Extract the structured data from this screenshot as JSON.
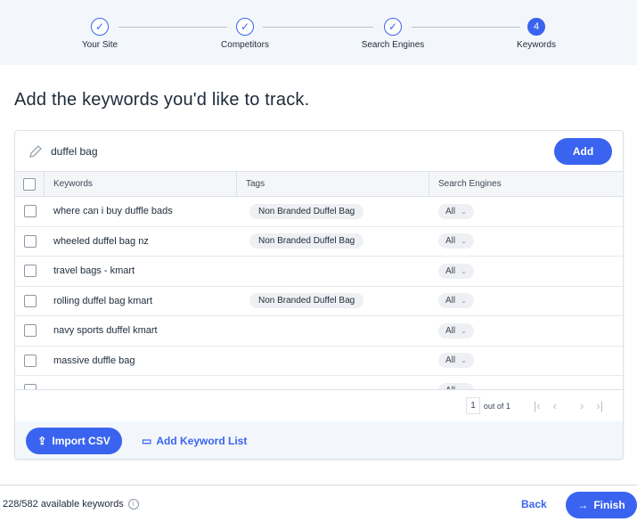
{
  "stepper": {
    "steps": [
      {
        "label": "Your Site",
        "state": "done"
      },
      {
        "label": "Competitors",
        "state": "done"
      },
      {
        "label": "Search Engines",
        "state": "done"
      },
      {
        "label": "Keywords",
        "state": "active",
        "number": "4"
      }
    ]
  },
  "title": "Add the keywords you'd like to track.",
  "input": {
    "value": "duffel bag",
    "add_label": "Add"
  },
  "table": {
    "headers": [
      "Keywords",
      "Tags",
      "Search Engines"
    ],
    "rows": [
      {
        "keyword": "where can i buy duffle bads",
        "tag": "Non Branded Duffel Bag",
        "engine": "All"
      },
      {
        "keyword": "wheeled duffel bag nz",
        "tag": "Non Branded Duffel Bag",
        "engine": "All"
      },
      {
        "keyword": "travel bags - kmart",
        "tag": "",
        "engine": "All"
      },
      {
        "keyword": "rolling duffel bag kmart",
        "tag": "Non Branded Duffel Bag",
        "engine": "All"
      },
      {
        "keyword": "navy sports duffel kmart",
        "tag": "",
        "engine": "All"
      },
      {
        "keyword": "massive duffle bag",
        "tag": "",
        "engine": "All"
      },
      {
        "keyword": "",
        "tag": "",
        "engine": "All"
      }
    ]
  },
  "pagination": {
    "page": "1",
    "total_text": "out of 1"
  },
  "actions": {
    "import_label": "Import CSV",
    "keyword_list_label": "Add Keyword List"
  },
  "footer": {
    "available": "228/582 available keywords",
    "back_label": "Back",
    "finish_label": "Finish"
  },
  "colors": {
    "accent": "#3a64f0",
    "header_bg": "#f3f7fb"
  }
}
